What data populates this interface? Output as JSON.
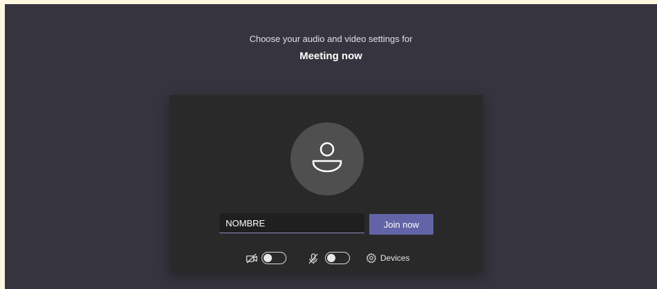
{
  "header": {
    "subtitle": "Choose your audio and video settings for",
    "meeting_title": "Meeting now"
  },
  "join": {
    "name_value": "NOMBRE",
    "join_label": "Join now"
  },
  "controls": {
    "camera_icon": "video-off-icon",
    "camera_on": false,
    "mic_icon": "mic-off-icon",
    "mic_on": false,
    "devices_icon": "gear-icon",
    "devices_label": "Devices"
  },
  "colors": {
    "background": "#36353f",
    "card": "#292929",
    "accent": "#6264a7",
    "avatar": "#4f4f4f"
  }
}
